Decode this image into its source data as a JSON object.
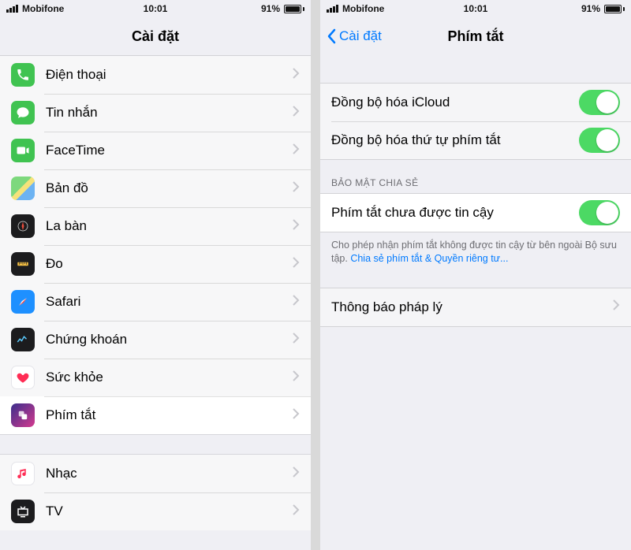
{
  "status": {
    "carrier": "Mobifone",
    "time": "10:01",
    "battery": "91%"
  },
  "left": {
    "title": "Cài đặt",
    "items": [
      {
        "key": "phone",
        "label": "Điện thoại"
      },
      {
        "key": "messages",
        "label": "Tin nhắn"
      },
      {
        "key": "facetime",
        "label": "FaceTime"
      },
      {
        "key": "maps",
        "label": "Bản đồ"
      },
      {
        "key": "compass",
        "label": "La bàn"
      },
      {
        "key": "measure",
        "label": "Đo"
      },
      {
        "key": "safari",
        "label": "Safari"
      },
      {
        "key": "stocks",
        "label": "Chứng khoán"
      },
      {
        "key": "health",
        "label": "Sức khỏe"
      },
      {
        "key": "shortcuts",
        "label": "Phím tắt"
      }
    ],
    "items2": [
      {
        "key": "music",
        "label": "Nhạc"
      },
      {
        "key": "tv",
        "label": "TV"
      }
    ]
  },
  "right": {
    "back": "Cài đặt",
    "title": "Phím tắt",
    "sync": {
      "icloud": "Đồng bộ hóa iCloud",
      "order": "Đồng bộ hóa thứ tự phím tắt"
    },
    "security_header": "BẢO MẬT CHIA SẺ",
    "untrusted": "Phím tắt chưa được tin cậy",
    "footer_a": "Cho phép nhận phím tắt không được tin cậy từ bên ngoài Bộ sưu tập. ",
    "footer_link": "Chia sẻ phím tắt & Quyền riêng tư...",
    "legal": "Thông báo pháp lý"
  }
}
